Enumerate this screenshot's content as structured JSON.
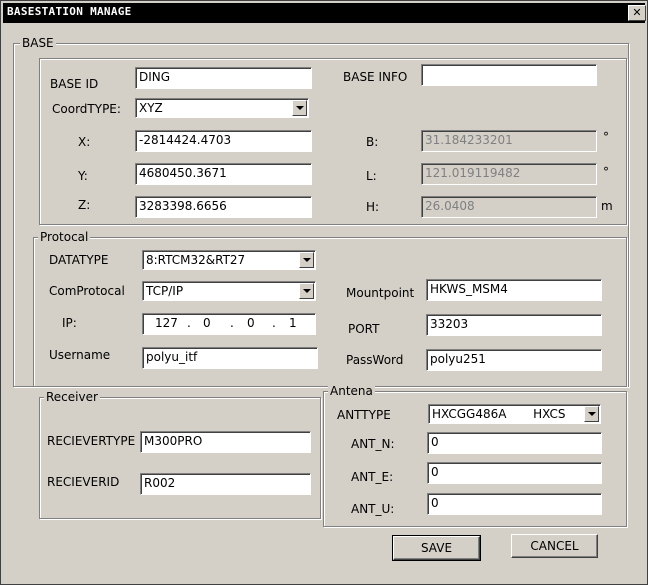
{
  "window": {
    "title": "BASESTATION MANAGE",
    "close_glyph": "✕"
  },
  "base": {
    "legend": "BASE",
    "base_id_label": "BASE ID",
    "base_id_value": "DING",
    "base_info_label": "BASE INFO",
    "base_info_value": "",
    "coord_type_label": "CoordTYPE:",
    "coord_type_value": "XYZ",
    "x_label": "X:",
    "x_value": "-2814424.4703",
    "y_label": "Y:",
    "y_value": "4680450.3671",
    "z_label": "Z:",
    "z_value": "3283398.6656",
    "b_label": "B:",
    "b_value": "31.184233201",
    "b_unit": "°",
    "l_label": "L:",
    "l_value": "121.019119482",
    "l_unit": "°",
    "h_label": "H:",
    "h_value": "26.0408",
    "h_unit": "m"
  },
  "protocol": {
    "legend": "Protocal",
    "datatype_label": "DATATYPE",
    "datatype_value": "8:RTCM32&RT27",
    "comprotocol_label": "ComProtocal",
    "comprotocol_value": "TCP/IP",
    "ip_label": "IP:",
    "ip_octets": [
      "127",
      "0",
      "0",
      "1"
    ],
    "ip_dot": ".",
    "username_label": "Username",
    "username_value": "polyu_itf",
    "mountpoint_label": "Mountpoint",
    "mountpoint_value": "HKWS_MSM4",
    "port_label": "PORT",
    "port_value": "33203",
    "password_label": "PassWord",
    "password_value": "polyu251"
  },
  "receiver": {
    "legend": "Receiver",
    "type_label": "RECIEVERTYPE",
    "type_value": "M300PRO",
    "id_label": "RECIEVERID",
    "id_value": "R002"
  },
  "antenna": {
    "legend": "Antena",
    "type_label": "ANTTYPE",
    "type_value": "HXCGG486A       HXCS",
    "n_label": "ANT_N:",
    "n_value": "0",
    "e_label": "ANT_E:",
    "e_value": "0",
    "u_label": "ANT_U:",
    "u_value": "0"
  },
  "buttons": {
    "save": "SAVE",
    "cancel": "CANCEL"
  }
}
